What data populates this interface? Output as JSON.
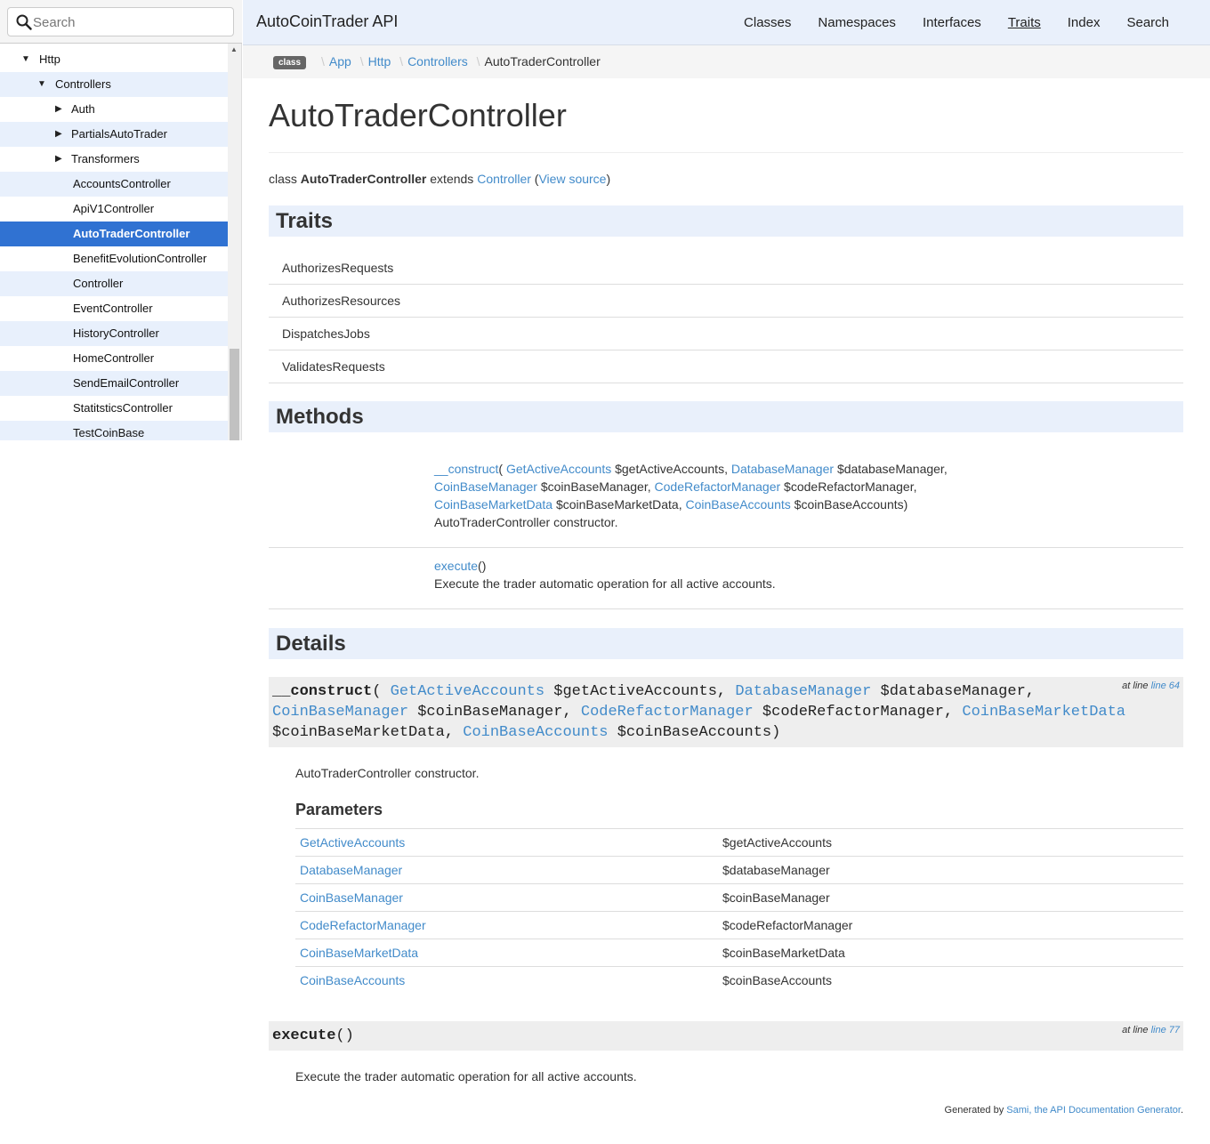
{
  "search": {
    "placeholder": "Search"
  },
  "tree": [
    {
      "label": "Http",
      "arrow": "▼",
      "depth": 0,
      "alt": false,
      "active": false
    },
    {
      "label": "Controllers",
      "arrow": "▼",
      "depth": 1,
      "alt": true,
      "active": false
    },
    {
      "label": "Auth",
      "arrow": "▶",
      "depth": 2,
      "alt": false,
      "active": false
    },
    {
      "label": "PartialsAutoTrader",
      "arrow": "▶",
      "depth": 2,
      "alt": true,
      "active": false
    },
    {
      "label": "Transformers",
      "arrow": "▶",
      "depth": 2,
      "alt": false,
      "active": false
    },
    {
      "label": "AccountsController",
      "arrow": "",
      "depth": 3,
      "alt": true,
      "active": false
    },
    {
      "label": "ApiV1Controller",
      "arrow": "",
      "depth": 3,
      "alt": false,
      "active": false
    },
    {
      "label": "AutoTraderController",
      "arrow": "",
      "depth": 3,
      "alt": false,
      "active": true
    },
    {
      "label": "BenefitEvolutionController",
      "arrow": "",
      "depth": 3,
      "alt": false,
      "active": false
    },
    {
      "label": "Controller",
      "arrow": "",
      "depth": 3,
      "alt": true,
      "active": false
    },
    {
      "label": "EventController",
      "arrow": "",
      "depth": 3,
      "alt": false,
      "active": false
    },
    {
      "label": "HistoryController",
      "arrow": "",
      "depth": 3,
      "alt": true,
      "active": false
    },
    {
      "label": "HomeController",
      "arrow": "",
      "depth": 3,
      "alt": false,
      "active": false
    },
    {
      "label": "SendEmailController",
      "arrow": "",
      "depth": 3,
      "alt": true,
      "active": false
    },
    {
      "label": "StatitsticsController",
      "arrow": "",
      "depth": 3,
      "alt": false,
      "active": false
    },
    {
      "label": "TestCoinBase",
      "arrow": "",
      "depth": 3,
      "alt": true,
      "active": false
    }
  ],
  "nav": {
    "brand": "AutoCoinTrader API",
    "links": [
      "Classes",
      "Namespaces",
      "Interfaces",
      "Traits",
      "Index",
      "Search"
    ],
    "current": "Traits"
  },
  "breadcrumb": {
    "badge": "class",
    "items": [
      "App",
      "Http",
      "Controllers"
    ],
    "current": "AutoTraderController"
  },
  "page": {
    "title": "AutoTraderController",
    "class_prefix": "class",
    "class_name": "AutoTraderController",
    "extends_word": "extends",
    "parent": "Controller",
    "view_source": "View source"
  },
  "sections": {
    "traits": "Traits",
    "methods": "Methods",
    "details": "Details",
    "parameters": "Parameters"
  },
  "traits": [
    "AuthorizesRequests",
    "AuthorizesResources",
    "DispatchesJobs",
    "ValidatesRequests"
  ],
  "methods": {
    "construct_name": "__construct",
    "construct_desc": "AutoTraderController constructor.",
    "execute_name": "execute",
    "execute_desc": "Execute the trader automatic operation for all active accounts."
  },
  "params": [
    {
      "type": "GetActiveAccounts",
      "name": "$getActiveAccounts"
    },
    {
      "type": "DatabaseManager",
      "name": "$databaseManager"
    },
    {
      "type": "CoinBaseManager",
      "name": "$coinBaseManager"
    },
    {
      "type": "CodeRefactorManager",
      "name": "$codeRefactorManager"
    },
    {
      "type": "CoinBaseMarketData",
      "name": "$coinBaseMarketData"
    },
    {
      "type": "CoinBaseAccounts",
      "name": "$coinBaseAccounts"
    }
  ],
  "details": {
    "at_line_label": "at line",
    "construct_line": "line 64",
    "execute_line": "line 77"
  },
  "footer": {
    "prefix": "Generated by",
    "link": "Sami, the API Documentation Generator",
    "suffix": "."
  },
  "colors": {
    "link": "#428bca",
    "active_tree": "#3072d2",
    "alt_row": "#e8f0fc",
    "navbar": "#e9f0fb"
  }
}
